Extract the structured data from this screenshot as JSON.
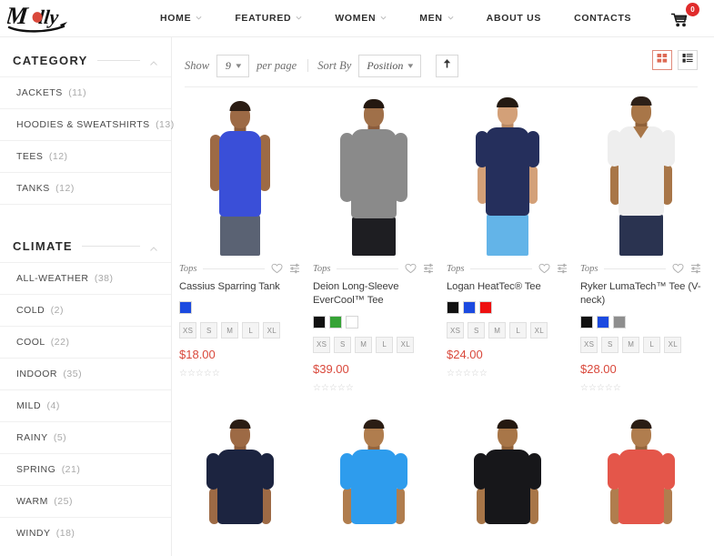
{
  "brand": {
    "name": "Molly",
    "logo_icon": "molly-script-logo"
  },
  "header": {
    "nav": [
      {
        "label": "HOME",
        "has_dropdown": true
      },
      {
        "label": "FEATURED",
        "has_dropdown": true
      },
      {
        "label": "WOMEN",
        "has_dropdown": true
      },
      {
        "label": "MEN",
        "has_dropdown": true
      },
      {
        "label": "ABOUT US",
        "has_dropdown": false
      },
      {
        "label": "CONTACTS",
        "has_dropdown": false
      }
    ],
    "cart": {
      "icon": "shopping-cart-icon",
      "count": "0",
      "badge_color": "#e02b2b"
    }
  },
  "sidebar": {
    "filters": [
      {
        "title": "CATEGORY",
        "collapse_icon": "chevron-up-icon",
        "items": [
          {
            "label": "JACKETS",
            "count": "(11)"
          },
          {
            "label": "HOODIES & SWEATSHIRTS",
            "count": "(13)"
          },
          {
            "label": "TEES",
            "count": "(12)"
          },
          {
            "label": "TANKS",
            "count": "(12)"
          }
        ]
      },
      {
        "title": "CLIMATE",
        "collapse_icon": "chevron-up-icon",
        "items": [
          {
            "label": "ALL-WEATHER",
            "count": "(38)"
          },
          {
            "label": "COLD",
            "count": "(2)"
          },
          {
            "label": "COOL",
            "count": "(22)"
          },
          {
            "label": "INDOOR",
            "count": "(35)"
          },
          {
            "label": "MILD",
            "count": "(4)"
          },
          {
            "label": "RAINY",
            "count": "(5)"
          },
          {
            "label": "SPRING",
            "count": "(21)"
          },
          {
            "label": "WARM",
            "count": "(25)"
          },
          {
            "label": "WINDY",
            "count": "(18)"
          }
        ]
      }
    ]
  },
  "toolbar": {
    "show_label": "Show",
    "per_page_value": "9",
    "per_page_label": "per page",
    "sort_label": "Sort By",
    "sort_value": "Position",
    "sort_direction_icon": "arrow-up-icon",
    "grid_view_icon": "grid-view-icon",
    "list_view_icon": "list-view-icon",
    "active_view": "grid",
    "active_view_color": "#e08a7a"
  },
  "products": [
    {
      "category": "Tops",
      "name": "Cassius Sparring Tank",
      "price": "$18.00",
      "colors": [
        "#1b4ae0"
      ],
      "sizes": [
        "XS",
        "S",
        "M",
        "L",
        "XL"
      ],
      "rating": "☆☆☆☆☆",
      "wishlist_icon": "heart-icon",
      "compare_icon": "compare-sliders-icon",
      "photo": {
        "shirt": "#3a4fd8",
        "shirt_type": "tank",
        "shorts": "#5a6273",
        "skin": "#9d6a45",
        "hair": "#2b1d14"
      }
    },
    {
      "category": "Tops",
      "name": "Deion Long-Sleeve EverCool™ Tee",
      "price": "$39.00",
      "colors": [
        "#111111",
        "#36a336",
        "#ffffff"
      ],
      "sizes": [
        "XS",
        "S",
        "M",
        "L",
        "XL"
      ],
      "rating": "☆☆☆☆☆",
      "wishlist_icon": "heart-icon",
      "compare_icon": "compare-sliders-icon",
      "photo": {
        "shirt": "#8a8a8a",
        "shirt_type": "long",
        "shorts": "#1e1e22",
        "skin": "#a07049",
        "hair": "#241810"
      }
    },
    {
      "category": "Tops",
      "name": "Logan HeatTec® Tee",
      "price": "$24.00",
      "colors": [
        "#111111",
        "#1b4ae0",
        "#ee1111"
      ],
      "sizes": [
        "XS",
        "S",
        "M",
        "L",
        "XL"
      ],
      "rating": "☆☆☆☆☆",
      "wishlist_icon": "heart-icon",
      "compare_icon": "compare-sliders-icon",
      "photo": {
        "shirt": "#252f5c",
        "shirt_type": "short",
        "shorts": "#63b4e8",
        "skin": "#d3a078",
        "hair": "#241a12"
      }
    },
    {
      "category": "Tops",
      "name": "Ryker LumaTech™ Tee (V-neck)",
      "price": "$28.00",
      "colors": [
        "#111111",
        "#1b4ae0",
        "#8e8e8e"
      ],
      "sizes": [
        "XS",
        "S",
        "M",
        "L",
        "XL"
      ],
      "rating": "☆☆☆☆☆",
      "wishlist_icon": "heart-icon",
      "compare_icon": "compare-sliders-icon",
      "photo": {
        "shirt": "#eeeeee",
        "shirt_type": "vneck",
        "shorts": "#2a3350",
        "skin": "#a87648",
        "hair": "#2d2018"
      }
    }
  ],
  "products_row2": [
    {
      "photo": {
        "shirt": "#1c2440",
        "shirt_type": "short",
        "skin": "#9d6a45",
        "hair": "#2b1d14"
      }
    },
    {
      "photo": {
        "shirt": "#2e9ced",
        "shirt_type": "short",
        "skin": "#b07d4e",
        "hair": "#2b1d14"
      }
    },
    {
      "photo": {
        "shirt": "#17171a",
        "shirt_type": "short",
        "skin": "#a87648",
        "hair": "#241810"
      }
    },
    {
      "photo": {
        "shirt": "#e4564a",
        "shirt_type": "short",
        "skin": "#b07d4e",
        "hair": "#2b1d14"
      }
    }
  ]
}
